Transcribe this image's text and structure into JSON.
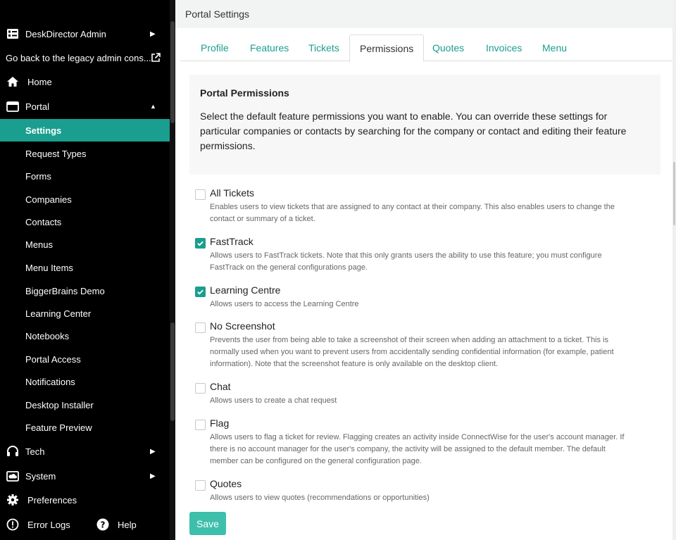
{
  "sidebar": {
    "admin_label": "DeskDirector Admin",
    "legacy_label": "Go back to the legacy admin cons...",
    "home_label": "Home",
    "portal_label": "Portal",
    "portal_items": [
      {
        "label": "Settings"
      },
      {
        "label": "Request Types"
      },
      {
        "label": "Forms"
      },
      {
        "label": "Companies"
      },
      {
        "label": "Contacts"
      },
      {
        "label": "Menus"
      },
      {
        "label": "Menu Items"
      },
      {
        "label": "BiggerBrains Demo"
      },
      {
        "label": "Learning Center"
      },
      {
        "label": "Notebooks"
      },
      {
        "label": "Portal Access"
      },
      {
        "label": "Notifications"
      },
      {
        "label": "Desktop Installer"
      },
      {
        "label": "Feature Preview"
      }
    ],
    "tech_label": "Tech",
    "system_label": "System",
    "preferences_label": "Preferences",
    "error_logs_label": "Error Logs",
    "help_label": "Help",
    "active_color": "#1a9e8f"
  },
  "header": {
    "title": "Portal Settings"
  },
  "tabs": [
    {
      "label": "Profile"
    },
    {
      "label": "Features"
    },
    {
      "label": "Tickets"
    },
    {
      "label": "Permissions"
    },
    {
      "label": "Quotes"
    },
    {
      "label": "Invoices"
    },
    {
      "label": "Menu"
    }
  ],
  "panel": {
    "title": "Portal Permissions",
    "description": "Select the default feature permissions you want to enable. You can override these settings for particular companies or contacts by searching for the company or contact and editing their feature permissions."
  },
  "permissions": [
    {
      "title": "All Tickets",
      "checked": false,
      "desc": "Enables users to view tickets that are assigned to any contact at their company. This also enables users to change the contact or summary of a ticket."
    },
    {
      "title": "FastTrack",
      "checked": true,
      "desc": "Allows users to FastTrack tickets. Note that this only grants users the ability to use this feature; you must configure FastTrack on the general configurations page."
    },
    {
      "title": "Learning Centre",
      "checked": true,
      "desc": "Allows users to access the Learning Centre"
    },
    {
      "title": "No Screenshot",
      "checked": false,
      "desc": "Prevents the user from being able to take a screenshot of their screen when adding an attachment to a ticket. This is normally used when you want to prevent users from accidentally sending confidential information (for example, patient information). Note that the screenshot feature is only available on the desktop client."
    },
    {
      "title": "Chat",
      "checked": false,
      "desc": "Allows users to create a chat request"
    },
    {
      "title": "Flag",
      "checked": false,
      "desc": "Allows users to flag a ticket for review. Flagging creates an activity inside ConnectWise for the user's account manager. If there is no account manager for the user's company, the activity will be assigned to the default member. The default member can be configured on the general configuration page."
    },
    {
      "title": "Quotes",
      "checked": false,
      "desc": "Allows users to view quotes (recommendations or opportunities)"
    }
  ],
  "save_label": "Save",
  "accent_color": "#1a9e8f"
}
